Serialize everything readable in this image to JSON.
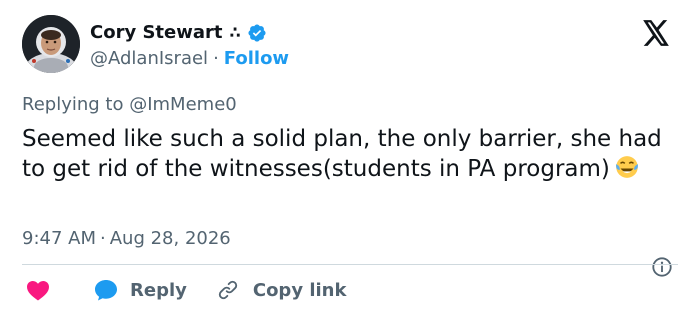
{
  "author": {
    "display_name": "Cory Stewart",
    "name_suffix": "∴",
    "handle": "@AdlanIsrael",
    "separator": "·",
    "follow_label": "Follow"
  },
  "tweet": {
    "replying_prefix": "Replying to",
    "replying_to": "@ImMeme0",
    "text": "Seemed like such a solid plan, the only barrier, she had to get rid of the witnesses(students in PA program)",
    "emoji": "face-with-tears-of-joy",
    "time": "9:47 AM",
    "date": "Aug 28, 2026",
    "separator": "·"
  },
  "actions": {
    "reply_label": "Reply",
    "copy_link_label": "Copy link"
  },
  "icons": {
    "verified": "verified-badge-icon",
    "platform": "x-logo-icon",
    "info": "info-icon",
    "like": "heart-icon",
    "reply": "reply-bubble-icon",
    "copy": "link-icon"
  },
  "colors": {
    "accent": "#1d9bf0",
    "like": "#f91880",
    "text": "#0f1419",
    "muted": "#536471"
  }
}
